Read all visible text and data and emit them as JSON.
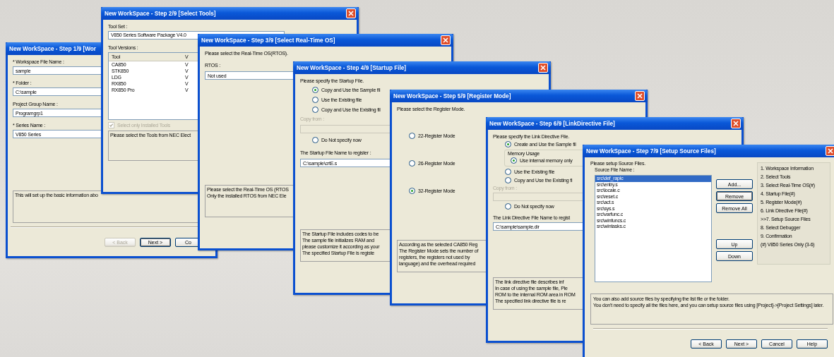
{
  "desktop": {
    "windows": [
      {
        "kind": "form",
        "title": "New WorkSpace - Step 1/9 [Wor",
        "body": [
          {
            "kind": "label",
            "text": "* Workspace File Name :"
          },
          {
            "kind": "field",
            "value": "sample"
          },
          {
            "kind": "label",
            "text": "* Folder :"
          },
          {
            "kind": "field",
            "value": "C:\\sample"
          },
          {
            "kind": "label",
            "text": "Project Group Name :"
          },
          {
            "kind": "field",
            "value": "Programgrp1"
          },
          {
            "kind": "label",
            "text": "* Series Name :"
          },
          {
            "kind": "dropdown",
            "value": "V850 Series"
          },
          {
            "kind": "description",
            "lines": [
              "This will set up the basic information abo"
            ]
          }
        ],
        "buttons": [
          {
            "label": "< Back",
            "disabled": true,
            "focused": false
          },
          {
            "label": "Next >",
            "disabled": false,
            "focused": true
          },
          {
            "label": "Co",
            "disabled": false,
            "focused": false
          }
        ]
      },
      {
        "kind": "form",
        "title": "New WorkSpace - Step 2/9 [Select Tools]",
        "body": [
          {
            "kind": "label",
            "text": "Tool Set :"
          },
          {
            "kind": "field",
            "value": "V850 Series Software Package V4.0"
          },
          {
            "kind": "label",
            "text": "Tool Versions :"
          },
          {
            "kind": "table",
            "columns": [
              "Tool",
              "V"
            ],
            "rows": [
              [
                "CA850",
                "V"
              ],
              [
                "STK850",
                "V"
              ],
              [
                "LDG",
                "V"
              ],
              [
                "RX850",
                "V"
              ],
              [
                "RX850 Pro",
                "V"
              ]
            ]
          },
          {
            "kind": "checkbox",
            "label": "Select only Installed Tools",
            "checked": true,
            "disabled": true
          },
          {
            "kind": "description",
            "lines": [
              "Please select the Tools from NEC Elect"
            ]
          }
        ]
      },
      {
        "kind": "form",
        "title": "New WorkSpace - Step 3/9 [Select Real-Time OS]",
        "body": [
          {
            "kind": "label",
            "text": "Please select the Real-Time OS(RTOS)."
          },
          {
            "kind": "label",
            "text": "RTOS :"
          },
          {
            "kind": "field",
            "value": "Not used"
          },
          {
            "kind": "description",
            "lines": [
              "Please select the Real-Time OS (RTOS",
              "Only the installed RTOS from NEC Ele"
            ]
          }
        ]
      },
      {
        "kind": "form",
        "title": "New WorkSpace - Step 4/9 [Startup File]",
        "body": [
          {
            "kind": "label",
            "text": "Please specify the Startup File."
          },
          {
            "kind": "radio",
            "label": "Copy and Use the Sample fil",
            "selected": true
          },
          {
            "kind": "radio",
            "label": "Use the Existing file",
            "selected": false
          },
          {
            "kind": "radio",
            "label": "Copy and Use the Existing fil",
            "selected": false
          },
          {
            "kind": "label",
            "text": "Copy from :",
            "disabled": true
          },
          {
            "kind": "field",
            "disabled": true
          },
          {
            "kind": "radio",
            "label": "Do Not specify now",
            "selected": false
          },
          {
            "kind": "label",
            "text": "The Startup File Name to register :"
          },
          {
            "kind": "field",
            "value": "C:\\sample\\crtE.s"
          },
          {
            "kind": "description",
            "lines": [
              "The Startup File includes codes to be",
              "The sample file initializes RAM and",
              "please customize it according as your",
              "The specified Startup File is registe"
            ]
          }
        ]
      },
      {
        "kind": "form",
        "title": "New WorkSpace - Step 5/9 [Register Mode]",
        "body": [
          {
            "kind": "label",
            "text": "Please select the Register Mode."
          },
          {
            "kind": "radio",
            "label": "22-Register Mode",
            "selected": false
          },
          {
            "kind": "radio",
            "label": "26-Register Mode",
            "selected": false
          },
          {
            "kind": "radio",
            "label": "32-Register Mode",
            "selected": true
          },
          {
            "kind": "description",
            "lines": [
              "According as the selected CA850 Reg",
              "The Register Mode sets the number of",
              "registers, the registers not used by",
              "language) and the overhead required"
            ]
          }
        ]
      },
      {
        "kind": "form",
        "title": "New WorkSpace - Step 6/9 [LinkDirective File]",
        "body": [
          {
            "kind": "label",
            "text": "Please specify the Link Directive File."
          },
          {
            "kind": "radio",
            "label": "Create and Use the Sample fil",
            "selected": true
          },
          {
            "kind": "group",
            "label": "Memory Usage",
            "children": [
              {
                "kind": "radio",
                "label": "Use internal memory only",
                "selected": true
              }
            ]
          },
          {
            "kind": "radio",
            "label": "Use the Existing file",
            "selected": false
          },
          {
            "kind": "radio",
            "label": "Copy and Use the Existing fi",
            "selected": false
          },
          {
            "kind": "label",
            "text": "Copy from :",
            "disabled": true
          },
          {
            "kind": "field",
            "disabled": true
          },
          {
            "kind": "radio",
            "label": "Do Not specify now",
            "selected": false
          },
          {
            "kind": "label",
            "text": "The Link Directive File Name to regist"
          },
          {
            "kind": "field",
            "value": "C:\\sample\\sample.dir"
          },
          {
            "kind": "description",
            "lines": [
              "The link directive file describes inf",
              "In case of using the sample file, Ple",
              "ROM to the internal ROM area in ROM",
              "The specified link directive file is re"
            ]
          }
        ]
      },
      {
        "kind": "source-files",
        "title": "New WorkSpace - Step 7/9 [Setup Source Files]",
        "intro": "Please setup Source Files.",
        "list_label": "Source File Name :",
        "files": [
          {
            "name": "src\\def_rapic",
            "selected": true
          },
          {
            "name": "src\\entry.s",
            "selected": false
          },
          {
            "name": "src\\locale.c",
            "selected": false
          },
          {
            "name": "src\\reset.c",
            "selected": false
          },
          {
            "name": "src\\act.s",
            "selected": false
          },
          {
            "name": "src\\sys.s",
            "selected": false
          },
          {
            "name": "src\\varfunc.c",
            "selected": false
          },
          {
            "name": "src\\winfuncs.c",
            "selected": false
          },
          {
            "name": "src\\wintasks.c",
            "selected": false
          }
        ],
        "list_buttons": [
          {
            "label": "Add...",
            "focused": false
          },
          {
            "label": "Remove",
            "focused": true
          },
          {
            "label": "Remove All",
            "focused": false
          },
          {
            "label": "Up",
            "focused": false
          },
          {
            "label": "Down",
            "focused": false
          }
        ],
        "steps": [
          "1. Workspace Information",
          "2. Select Tools",
          "3. Select Real-Time OS(#)",
          "4. Startup File(#)",
          "5. Register Mode(#)",
          "6. Link Directive File(#)",
          ">>7. Setup Source Files",
          "8. Select Debugger",
          "9. Confirmation",
          "(#) V850 Series Only (3-6)"
        ],
        "description": [
          "You can also add source files by specifying the list file or the folder.",
          "You don't need to specify all the files here, and you can setup source files using [Project]->[Project Settings] later."
        ],
        "buttons": [
          {
            "label": "< Back",
            "disabled": false,
            "focused": false
          },
          {
            "label": "Next >",
            "disabled": false,
            "focused": false
          },
          {
            "label": "Cancel",
            "disabled": false,
            "focused": false
          },
          {
            "label": "Help",
            "disabled": false,
            "focused": false
          }
        ]
      }
    ]
  }
}
